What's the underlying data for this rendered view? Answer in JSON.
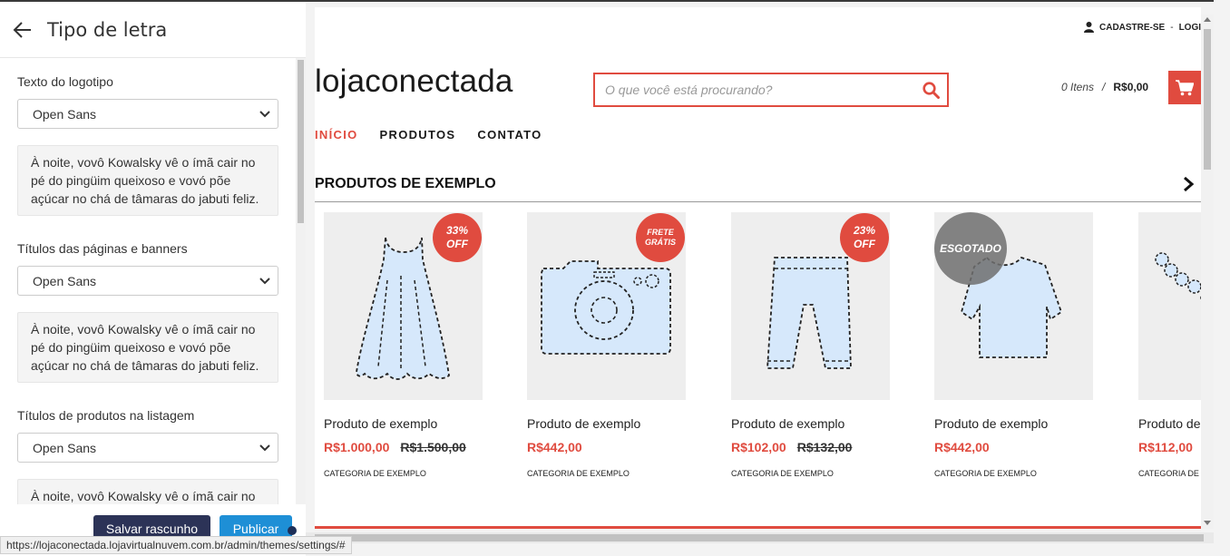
{
  "panel": {
    "title": "Tipo de letra",
    "sections": [
      {
        "label": "Texto do logotipo",
        "font": "Open Sans",
        "preview": "À noite, vovô Kowalsky vê o ímã cair no pé do pingüim queixoso e vovó põe açúcar no chá de tâmaras do jabuti feliz."
      },
      {
        "label": "Títulos das páginas e banners",
        "font": "Open Sans",
        "preview": "À noite, vovô Kowalsky vê o ímã cair no pé do pingüim queixoso e vovó põe açúcar no chá de tâmaras do jabuti feliz."
      },
      {
        "label": "Títulos de produtos na listagem",
        "font": "Open Sans",
        "preview": "À noite, vovô Kowalsky vê o ímã cair no pé do pingüim queixoso e vovó põe açúcar no chá de tâmaras do jabuti feliz."
      }
    ],
    "save_draft": "Salvar rascunho",
    "publish": "Publicar"
  },
  "status_url": "https://lojaconectada.lojavirtualnuvem.com.br/admin/themes/settings/#",
  "store": {
    "account": {
      "register": "CADASTRE-SE",
      "separator": "-",
      "login": "LOGIN"
    },
    "logo": "lojaconectada",
    "search_placeholder": "O que você está procurando?",
    "cart": {
      "items": "0 Itens",
      "separator": "/",
      "total": "R$0,00"
    },
    "nav": [
      {
        "label": "INÍCIO",
        "active": true
      },
      {
        "label": "PRODUTOS",
        "active": false
      },
      {
        "label": "CONTATO",
        "active": false
      }
    ],
    "section_title": "PRODUTOS DE EXEMPLO",
    "products": [
      {
        "name": "Produto de exemplo",
        "price": "R$1.000,00",
        "old_price": "R$1.500,00",
        "category": "CATEGORIA DE EXEMPLO",
        "badge_line1": "33%",
        "badge_line2": "OFF",
        "art": "dress"
      },
      {
        "name": "Produto de exemplo",
        "price": "R$442,00",
        "old_price": "",
        "category": "CATEGORIA DE EXEMPLO",
        "badge_line1": "FRETE",
        "badge_line2": "GRÁTIS",
        "art": "camera"
      },
      {
        "name": "Produto de exemplo",
        "price": "R$102,00",
        "old_price": "R$132,00",
        "category": "CATEGORIA DE EXEMPLO",
        "badge_line1": "23%",
        "badge_line2": "OFF",
        "art": "pants"
      },
      {
        "name": "Produto de exemplo",
        "price": "R$442,00",
        "old_price": "",
        "category": "CATEGORIA DE EXEMPLO",
        "soldout": "ESGOTADO",
        "art": "shirt"
      },
      {
        "name": "Produto de exemplo",
        "price": "R$112,00",
        "old_price": "",
        "category": "CATEGORIA DE EXEMPLO",
        "art": "necklace"
      }
    ],
    "colors": {
      "accent": "#e04b3f",
      "draft_button": "#2c3357",
      "publish_button": "#1e8fd6"
    }
  }
}
